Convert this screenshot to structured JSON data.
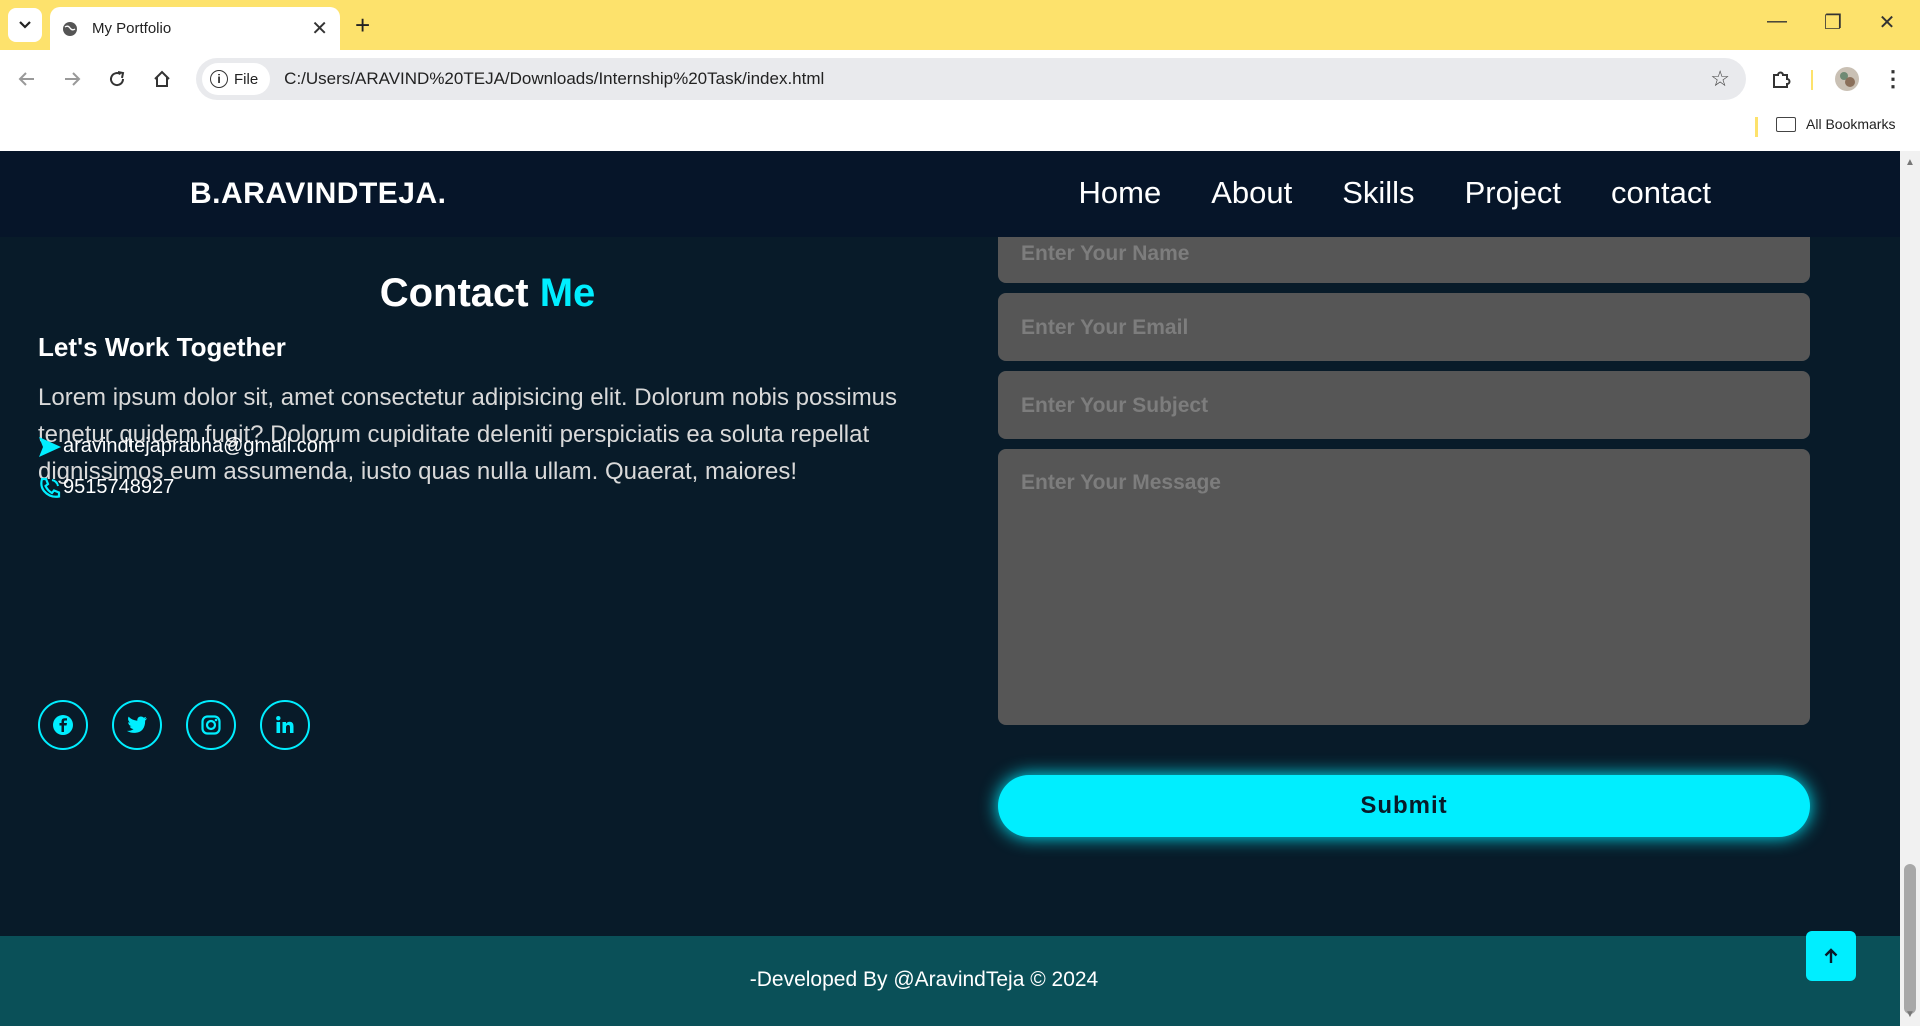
{
  "browser": {
    "tab_title": "My Portfolio",
    "tab_close": "✕",
    "new_tab": "+",
    "chip_label": "File",
    "url": "C:/Users/ARAVIND%20TEJA/Downloads/Internship%20Task/index.html",
    "bookmarks_label": "All Bookmarks",
    "minimize": "—",
    "restore": "❐",
    "close": "✕",
    "star": "☆",
    "menu": "⋮"
  },
  "site": {
    "logo": "B.ARAVINDTEJA.",
    "nav": [
      "Home",
      "About",
      "Skills",
      "Project",
      "contact"
    ]
  },
  "contact": {
    "title_main": "Contact ",
    "title_accent": "Me",
    "subtitle": "Let's Work Together",
    "description": "Lorem ipsum dolor sit, amet consectetur adipisicing elit. Dolorum nobis possimus tenetur quidem fugit? Dolorum cupiditate deleniti perspiciatis ea soluta repellat dignissimos eum assumenda, iusto quas nulla ullam. Quaerat, maiores!",
    "email": "aravindtejaprabha@gmail.com",
    "phone": "9515748927",
    "socials": [
      "facebook-icon",
      "twitter-icon",
      "instagram-icon",
      "linkedin-icon"
    ]
  },
  "form": {
    "name_placeholder": "Enter Your Name",
    "email_placeholder": "Enter Your Email",
    "subject_placeholder": "Enter Your Subject",
    "message_placeholder": "Enter Your Message",
    "submit_label": "Submit"
  },
  "footer": {
    "text": "-Developed By @AravindTeja © 2024"
  },
  "colors": {
    "accent": "#00eeff",
    "background": "#081b29",
    "header": "#061529",
    "footer": "#0a5058",
    "browser_frame": "#fde26c"
  }
}
